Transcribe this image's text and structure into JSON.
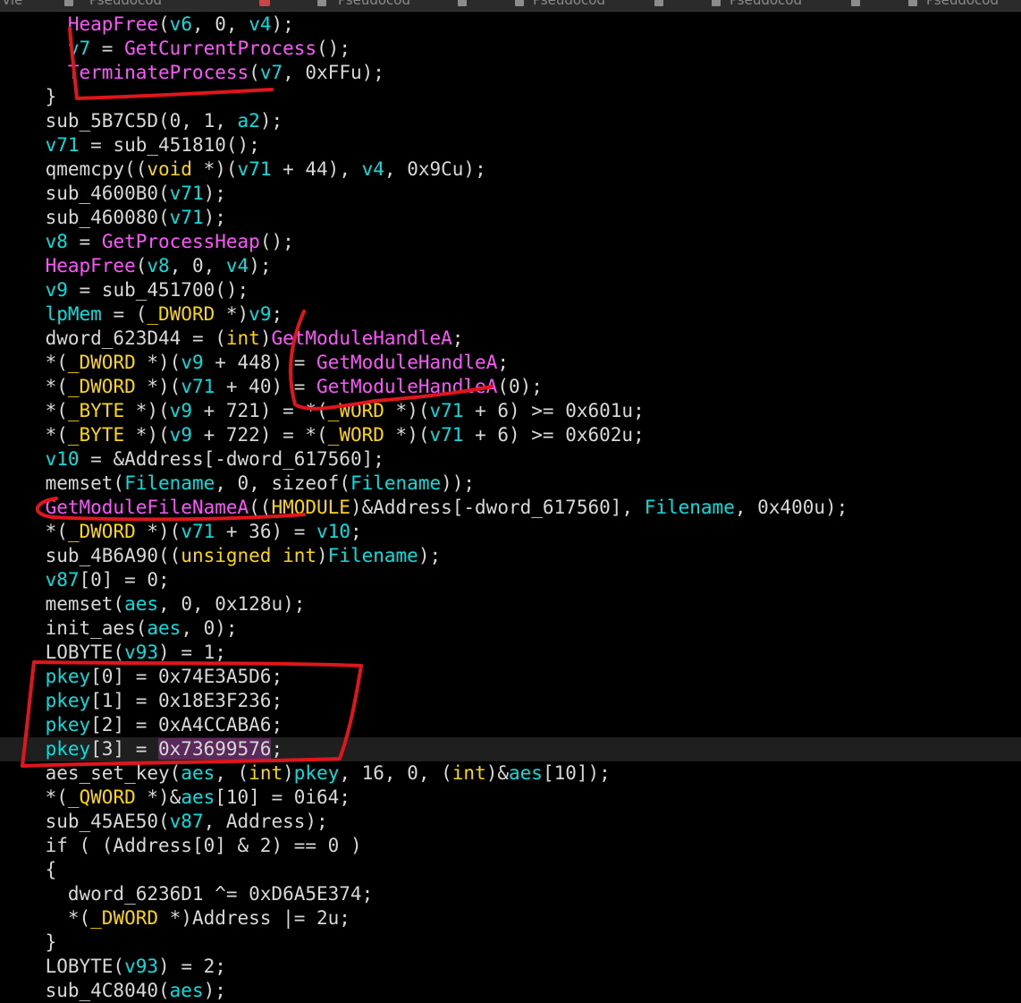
{
  "tabs": [
    {
      "label": "Pseudocod",
      "visible": "Vie"
    },
    {
      "label": "Pseudocod"
    },
    {
      "label": "Pseudocod"
    },
    {
      "label": "Pseudocod"
    },
    {
      "label": "Pseudocod"
    },
    {
      "label": "Pseudocod"
    }
  ],
  "colors": {
    "background": "#000000",
    "function": "#ff55ff",
    "variable": "#00e0e0",
    "type": "#ffd700",
    "text": "#d8d8d8",
    "annotation": "#e0161c"
  },
  "code_lines": [
    {
      "indent": "    ",
      "tokens": [
        [
          "fn",
          "HeapFree"
        ],
        [
          "txt",
          "("
        ],
        [
          "var",
          "v6"
        ],
        [
          "txt",
          ", 0, "
        ],
        [
          "var",
          "v4"
        ],
        [
          "txt",
          ");"
        ]
      ]
    },
    {
      "indent": "    ",
      "tokens": [
        [
          "var",
          "v7"
        ],
        [
          "txt",
          " = "
        ],
        [
          "fn",
          "GetCurrentProcess"
        ],
        [
          "txt",
          "();"
        ]
      ]
    },
    {
      "indent": "    ",
      "tokens": [
        [
          "fn",
          "TerminateProcess"
        ],
        [
          "txt",
          "("
        ],
        [
          "var",
          "v7"
        ],
        [
          "txt",
          ", 0xFFu);"
        ]
      ]
    },
    {
      "indent": "  ",
      "tokens": [
        [
          "txt",
          "}"
        ]
      ]
    },
    {
      "indent": "  ",
      "tokens": [
        [
          "txt",
          "sub_5B7C5D(0, 1, "
        ],
        [
          "var",
          "a2"
        ],
        [
          "txt",
          ");"
        ]
      ]
    },
    {
      "indent": "  ",
      "tokens": [
        [
          "var",
          "v71"
        ],
        [
          "txt",
          " = sub_451810();"
        ]
      ]
    },
    {
      "indent": "  ",
      "tokens": [
        [
          "txt",
          "qmemcpy(("
        ],
        [
          "type",
          "void"
        ],
        [
          "txt",
          " *)("
        ],
        [
          "var",
          "v71"
        ],
        [
          "txt",
          " + 44), "
        ],
        [
          "var",
          "v4"
        ],
        [
          "txt",
          ", 0x9Cu);"
        ]
      ]
    },
    {
      "indent": "  ",
      "tokens": [
        [
          "txt",
          "sub_4600B0("
        ],
        [
          "var",
          "v71"
        ],
        [
          "txt",
          ");"
        ]
      ]
    },
    {
      "indent": "  ",
      "tokens": [
        [
          "txt",
          "sub_460080("
        ],
        [
          "var",
          "v71"
        ],
        [
          "txt",
          ");"
        ]
      ]
    },
    {
      "indent": "  ",
      "tokens": [
        [
          "var",
          "v8"
        ],
        [
          "txt",
          " = "
        ],
        [
          "fn",
          "GetProcessHeap"
        ],
        [
          "txt",
          "();"
        ]
      ]
    },
    {
      "indent": "  ",
      "tokens": [
        [
          "fn",
          "HeapFree"
        ],
        [
          "txt",
          "("
        ],
        [
          "var",
          "v8"
        ],
        [
          "txt",
          ", 0, "
        ],
        [
          "var",
          "v4"
        ],
        [
          "txt",
          ");"
        ]
      ]
    },
    {
      "indent": "  ",
      "tokens": [
        [
          "var",
          "v9"
        ],
        [
          "txt",
          " = sub_451700();"
        ]
      ]
    },
    {
      "indent": "  ",
      "tokens": [
        [
          "var",
          "lpMem"
        ],
        [
          "txt",
          " = ("
        ],
        [
          "type",
          "_DWORD"
        ],
        [
          "txt",
          " *)"
        ],
        [
          "var",
          "v9"
        ],
        [
          "txt",
          ";"
        ]
      ]
    },
    {
      "indent": "  ",
      "tokens": [
        [
          "txt",
          "dword_623D44 = ("
        ],
        [
          "type",
          "int"
        ],
        [
          "txt",
          ")"
        ],
        [
          "fn",
          "GetModuleHandleA"
        ],
        [
          "txt",
          ";"
        ]
      ]
    },
    {
      "indent": "  ",
      "tokens": [
        [
          "txt",
          "*("
        ],
        [
          "type",
          "_DWORD"
        ],
        [
          "txt",
          " *)("
        ],
        [
          "var",
          "v9"
        ],
        [
          "txt",
          " + 448) = "
        ],
        [
          "fn",
          "GetModuleHandleA"
        ],
        [
          "txt",
          ";"
        ]
      ]
    },
    {
      "indent": "  ",
      "tokens": [
        [
          "txt",
          "*("
        ],
        [
          "type",
          "_DWORD"
        ],
        [
          "txt",
          " *)("
        ],
        [
          "var",
          "v71"
        ],
        [
          "txt",
          " + 40) = "
        ],
        [
          "fn",
          "GetModuleHandleA"
        ],
        [
          "txt",
          "(0);"
        ]
      ]
    },
    {
      "indent": "  ",
      "tokens": [
        [
          "txt",
          "*("
        ],
        [
          "type",
          "_BYTE"
        ],
        [
          "txt",
          " *)("
        ],
        [
          "var",
          "v9"
        ],
        [
          "txt",
          " + 721) = *("
        ],
        [
          "type",
          "_WORD"
        ],
        [
          "txt",
          " *)("
        ],
        [
          "var",
          "v71"
        ],
        [
          "txt",
          " + 6) >= 0x601u;"
        ]
      ]
    },
    {
      "indent": "  ",
      "tokens": [
        [
          "txt",
          "*("
        ],
        [
          "type",
          "_BYTE"
        ],
        [
          "txt",
          " *)("
        ],
        [
          "var",
          "v9"
        ],
        [
          "txt",
          " + 722) = *("
        ],
        [
          "type",
          "_WORD"
        ],
        [
          "txt",
          " *)("
        ],
        [
          "var",
          "v71"
        ],
        [
          "txt",
          " + 6) >= 0x602u;"
        ]
      ]
    },
    {
      "indent": "  ",
      "tokens": [
        [
          "var",
          "v10"
        ],
        [
          "txt",
          " = &Address[-dword_617560];"
        ]
      ]
    },
    {
      "indent": "  ",
      "tokens": [
        [
          "txt",
          "memset("
        ],
        [
          "var",
          "Filename"
        ],
        [
          "txt",
          ", 0, sizeof("
        ],
        [
          "var",
          "Filename"
        ],
        [
          "txt",
          "));"
        ]
      ]
    },
    {
      "indent": "  ",
      "tokens": [
        [
          "fn",
          "GetModuleFileNameA"
        ],
        [
          "txt",
          "(("
        ],
        [
          "type",
          "HMODULE"
        ],
        [
          "txt",
          ")&Address[-dword_617560], "
        ],
        [
          "var",
          "Filename"
        ],
        [
          "txt",
          ", 0x400u);"
        ]
      ]
    },
    {
      "indent": "  ",
      "tokens": [
        [
          "txt",
          "*("
        ],
        [
          "type",
          "_DWORD"
        ],
        [
          "txt",
          " *)("
        ],
        [
          "var",
          "v71"
        ],
        [
          "txt",
          " + 36) = "
        ],
        [
          "var",
          "v10"
        ],
        [
          "txt",
          ";"
        ]
      ]
    },
    {
      "indent": "  ",
      "tokens": [
        [
          "txt",
          "sub_4B6A90(("
        ],
        [
          "type",
          "unsigned int"
        ],
        [
          "txt",
          ")"
        ],
        [
          "var",
          "Filename"
        ],
        [
          "txt",
          ");"
        ]
      ]
    },
    {
      "indent": "  ",
      "tokens": [
        [
          "var",
          "v87"
        ],
        [
          "txt",
          "[0] = 0;"
        ]
      ]
    },
    {
      "indent": "  ",
      "tokens": [
        [
          "txt",
          "memset("
        ],
        [
          "var",
          "aes"
        ],
        [
          "txt",
          ", 0, 0x128u);"
        ]
      ]
    },
    {
      "indent": "  ",
      "tokens": [
        [
          "txt",
          "init_aes("
        ],
        [
          "var",
          "aes"
        ],
        [
          "txt",
          ", 0);"
        ]
      ]
    },
    {
      "indent": "  ",
      "tokens": [
        [
          "txt",
          "LOBYTE("
        ],
        [
          "var",
          "v93"
        ],
        [
          "txt",
          ") = 1;"
        ]
      ]
    },
    {
      "indent": "  ",
      "tokens": [
        [
          "var",
          "pkey"
        ],
        [
          "txt",
          "[0] = 0x74E3A5D6;"
        ]
      ]
    },
    {
      "indent": "  ",
      "tokens": [
        [
          "var",
          "pkey"
        ],
        [
          "txt",
          "[1] = 0x18E3F236;"
        ]
      ]
    },
    {
      "indent": "  ",
      "tokens": [
        [
          "var",
          "pkey"
        ],
        [
          "txt",
          "[2] = 0xA4CCABA6;"
        ]
      ]
    },
    {
      "indent": "  ",
      "highlight": true,
      "tokens": [
        [
          "var",
          "pkey"
        ],
        [
          "txt",
          "[3] = "
        ],
        [
          "sel",
          "0x73699576"
        ],
        [
          "txt",
          ";"
        ]
      ]
    },
    {
      "indent": "  ",
      "tokens": [
        [
          "txt",
          "aes_set_key("
        ],
        [
          "var",
          "aes"
        ],
        [
          "txt",
          ", ("
        ],
        [
          "type",
          "int"
        ],
        [
          "txt",
          ")"
        ],
        [
          "var",
          "pkey"
        ],
        [
          "txt",
          ", 16, 0, ("
        ],
        [
          "type",
          "int"
        ],
        [
          "txt",
          ")&"
        ],
        [
          "var",
          "aes"
        ],
        [
          "txt",
          "[10]);"
        ]
      ]
    },
    {
      "indent": "  ",
      "tokens": [
        [
          "txt",
          "*("
        ],
        [
          "type",
          "_QWORD"
        ],
        [
          "txt",
          " *)&"
        ],
        [
          "var",
          "aes"
        ],
        [
          "txt",
          "[10] = 0i64;"
        ]
      ]
    },
    {
      "indent": "  ",
      "tokens": [
        [
          "txt",
          "sub_45AE50("
        ],
        [
          "var",
          "v87"
        ],
        [
          "txt",
          ", Address);"
        ]
      ]
    },
    {
      "indent": "  ",
      "tokens": [
        [
          "txt",
          "if ( (Address[0] & 2) == 0 )"
        ]
      ]
    },
    {
      "indent": "  ",
      "tokens": [
        [
          "txt",
          "{"
        ]
      ]
    },
    {
      "indent": "    ",
      "tokens": [
        [
          "txt",
          "dword_6236D1 ^= 0xD6A5E374;"
        ]
      ]
    },
    {
      "indent": "    ",
      "tokens": [
        [
          "txt",
          "*("
        ],
        [
          "type",
          "_DWORD"
        ],
        [
          "txt",
          " *)Address |= 2u;"
        ]
      ]
    },
    {
      "indent": "  ",
      "tokens": [
        [
          "txt",
          "}"
        ]
      ]
    },
    {
      "indent": "  ",
      "tokens": [
        [
          "txt",
          "LOBYTE("
        ],
        [
          "var",
          "v93"
        ],
        [
          "txt",
          ") = 2;"
        ]
      ]
    },
    {
      "indent": "  ",
      "tokens": [
        [
          "txt",
          "sub_4C8040("
        ],
        [
          "var",
          "aes"
        ],
        [
          "txt",
          ");"
        ]
      ]
    }
  ]
}
